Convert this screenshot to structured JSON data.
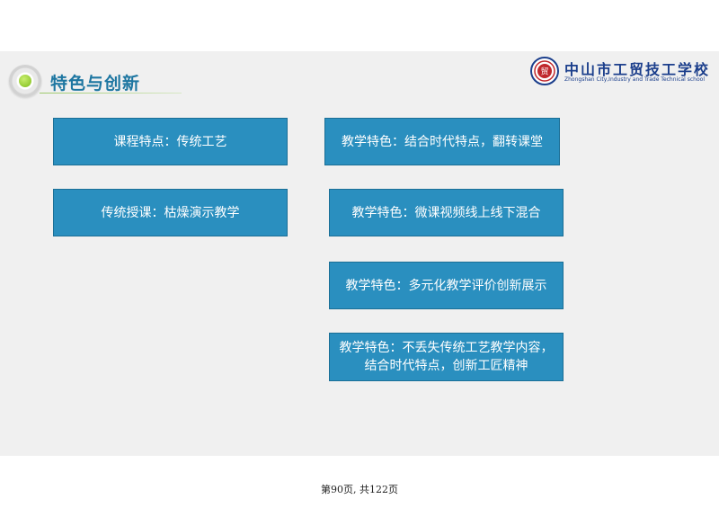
{
  "slide": {
    "title": "特色与创新"
  },
  "logo": {
    "cn_name": "中山市工贸技工学校",
    "en_name": "Zhongshan City,Industry and Trade Technical school",
    "emblem_char": "贸"
  },
  "boxes": {
    "course_feature": "课程特点：传统工艺",
    "traditional_teaching": "传统授课：枯燥演示教学",
    "feature_1": "教学特色：结合时代特点，翻转课堂",
    "feature_2": "教学特色：微课视频线上线下混合",
    "feature_3": "教学特色：多元化教学评价创新展示",
    "feature_4_line1": "教学特色：不丢失传统工艺教学内容，",
    "feature_4_line2": "结合时代特点，创新工匠精神"
  },
  "footer": {
    "page_text": "第90页, 共122页"
  },
  "colors": {
    "accent": "#1d76a1",
    "box_fill": "#2a8fbf",
    "box_border": "#1b6f96",
    "bullet_green": "#7dbb1a",
    "logo_blue": "#1c3f8c"
  }
}
